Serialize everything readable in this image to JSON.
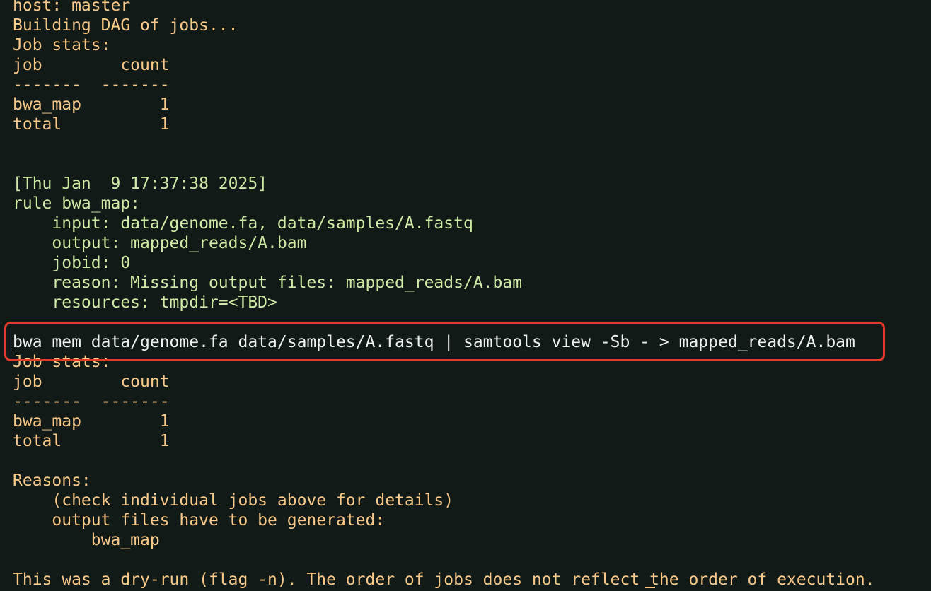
{
  "colors": {
    "background": "#121a17",
    "orange_text": "#f6c98b",
    "green_text": "#cfe9a6",
    "command_text": "#eef2ee",
    "highlight_border": "#e23a2c"
  },
  "output": {
    "host": "host: master",
    "building": "Building DAG of jobs...",
    "job_stats_1": {
      "title": "Job stats:",
      "header": "job        count",
      "separator": "-------  -------",
      "row_1": "bwa_map        1",
      "row_2": "total          1"
    },
    "rule_block": {
      "timestamp": "[Thu Jan  9 17:37:38 2025]",
      "rule": "rule bwa_map:",
      "input": "    input: data/genome.fa, data/samples/A.fastq",
      "output": "    output: mapped_reads/A.bam",
      "jobid": "    jobid: 0",
      "reason": "    reason: Missing output files: mapped_reads/A.bam",
      "resources": "    resources: tmpdir=<TBD>"
    },
    "command": "bwa mem data/genome.fa data/samples/A.fastq | samtools view -Sb - > mapped_reads/A.bam",
    "job_stats_2": {
      "title": "Job stats:",
      "header": "job        count",
      "separator": "-------  -------",
      "row_1": "bwa_map        1",
      "row_2": "total          1"
    },
    "reasons": {
      "title": "Reasons:",
      "line_1": "    (check individual jobs above for details)",
      "line_2": "    output files have to be generated:",
      "line_3": "        bwa_map"
    },
    "dry_run_note": "This was a dry-run (flag -n). The order of jobs does not reflect the order of execution."
  }
}
